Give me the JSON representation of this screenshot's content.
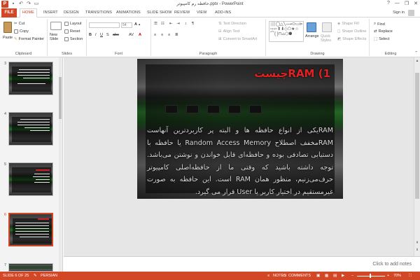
{
  "window": {
    "title": "حافظه رم کامپیوتر.pptx - PowerPoint",
    "app_logo": "P",
    "controls": [
      "?",
      "—",
      "❐",
      "✕"
    ]
  },
  "ribbon_tabs": {
    "file": "FILE",
    "tabs": [
      "HOME",
      "INSERT",
      "DESIGN",
      "TRANSITIONS",
      "ANIMATIONS",
      "SLIDE SHOW",
      "REVIEW",
      "VIEW",
      "ADD-INS"
    ],
    "sign_in": "Sign in"
  },
  "ribbon": {
    "clipboard": {
      "label": "Clipboard",
      "paste": "Paste",
      "cut": "Cut",
      "copy": "Copy",
      "format_painter": "Format Painter"
    },
    "slides": {
      "label": "Slides",
      "new_slide": "New Slide",
      "layout": "Layout",
      "reset": "Reset",
      "section": "Section"
    },
    "font": {
      "label": "Font",
      "size": "54"
    },
    "paragraph": {
      "label": "Paragraph",
      "text_direction": "Text Direction",
      "align_text": "Align Text",
      "convert_smartart": "Convert to SmartArt"
    },
    "drawing": {
      "label": "Drawing",
      "arrange": "Arrange",
      "quick_styles": "Quick Styles",
      "shape_fill": "Shape Fill",
      "shape_outline": "Shape Outline",
      "shape_effects": "Shape Effects"
    },
    "editing": {
      "label": "Editing",
      "find": "Find",
      "replace": "Replace",
      "select": "Select"
    }
  },
  "slides_pane": {
    "numbers": [
      "3",
      "4",
      "5",
      "6",
      "7"
    ],
    "selected_index": 3
  },
  "slide": {
    "title": "1)  RAMچیست",
    "body": "RAMیکی از انواع حافظه ها و البته پر کاربردترین آنهاست RAMمخفف اصطلاح Random Access Memory یا حافظه با دستیابی تصادفی بوده و حافظه‌ای قابل خواندن و نوشتن می‌باشد. توجه داشته باشید که وقتی ما از حافظه‌اصلی کامپیوتر حرف‌می‌زنیم، منظور همان RAM است. این حافظه به صورت غیرمستقیم در اختیار کاربر یا User قرار می گیرد."
  },
  "notes": {
    "placeholder": "Click to add notes"
  },
  "status_bar": {
    "slide_counter": "SLIDE 6 OF 25",
    "language": "PERSIAN",
    "notes": "NOTES",
    "comments": "COMMENTS",
    "zoom": "70%"
  },
  "colors": {
    "accent": "#d24726",
    "title_red": "#e02222"
  }
}
